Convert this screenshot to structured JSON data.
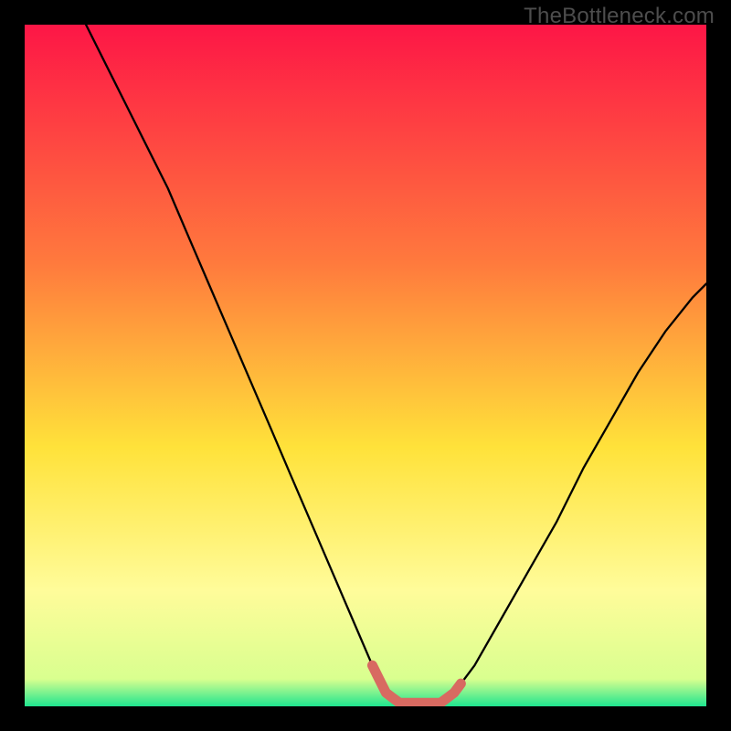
{
  "watermark": "TheBottleneck.com",
  "colors": {
    "frame_bg": "#000000",
    "grad_top": "#fd1646",
    "grad_mid1": "#ff7a3d",
    "grad_mid2": "#ffe23a",
    "grad_low": "#fffc9a",
    "grad_green": "#1fe58f",
    "curve": "#000000",
    "marker": "#d86a61"
  },
  "chart_data": {
    "type": "line",
    "title": "",
    "xlabel": "",
    "ylabel": "",
    "xlim": [
      0,
      100
    ],
    "ylim": [
      0,
      100
    ],
    "x": [
      9,
      12,
      15,
      18,
      21,
      24,
      27,
      30,
      33,
      36,
      39,
      42,
      45,
      48,
      51,
      53,
      55,
      57,
      59,
      61,
      63,
      66,
      70,
      74,
      78,
      82,
      86,
      90,
      94,
      98,
      100
    ],
    "values": [
      100,
      94,
      88,
      82,
      76,
      69,
      62,
      55,
      48,
      41,
      34,
      27,
      20,
      13,
      6,
      2,
      0.5,
      0,
      0,
      0.5,
      2,
      6,
      13,
      20,
      27,
      35,
      42,
      49,
      55,
      60,
      62
    ],
    "highlight_band": {
      "x_start": 51,
      "x_end": 64,
      "y": 0.5
    }
  }
}
